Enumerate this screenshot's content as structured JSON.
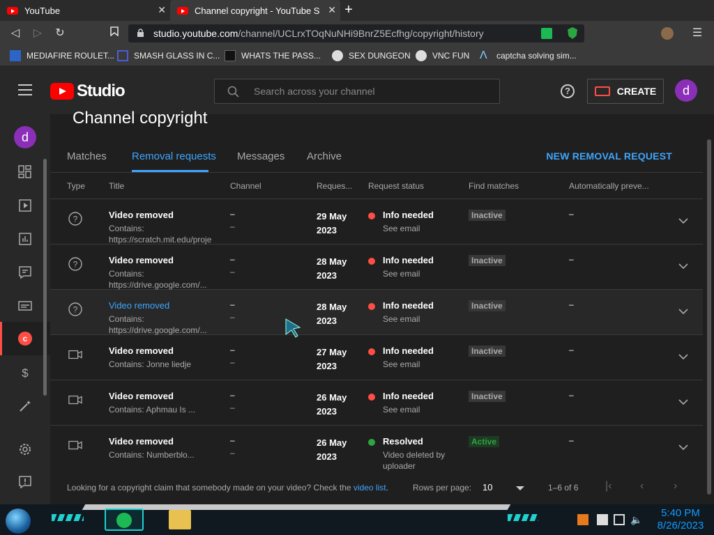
{
  "browser": {
    "tabs": [
      {
        "title": "YouTube"
      },
      {
        "title": "Channel copyright - YouTube Stud"
      }
    ],
    "url_host": "studio.youtube.com",
    "url_path": "/channel/UCLrxTOqNuNHi9BnrZ5Ecfhg/copyright/history",
    "bookmarks": [
      "MEDIAFIRE ROULET...",
      "SMASH GLASS IN C...",
      "WHATS THE PASS...",
      "SEX DUNGEON",
      "VNC FUN",
      "captcha solving sim..."
    ]
  },
  "header": {
    "logo_text": "Studio",
    "search_placeholder": "Search across your channel",
    "help_glyph": "?",
    "create_label": "CREATE",
    "avatar_letter": "d"
  },
  "sidebar": {
    "avatar_letter": "d",
    "copyright_letter": "c"
  },
  "main": {
    "title": "Channel copyright",
    "tabs": [
      "Matches",
      "Removal requests",
      "Messages",
      "Archive"
    ],
    "active_tab": "Removal requests",
    "new_request_label": "NEW REMOVAL REQUEST",
    "columns": [
      "Type",
      "Title",
      "Channel",
      "Reques...",
      "Request status",
      "Find matches",
      "Automatically preve..."
    ],
    "rows": [
      {
        "type": "question-icon",
        "title": "Video removed",
        "contains": "Contains: https://scratch.mit.edu/proje",
        "channel": "–",
        "channel_sub": "–",
        "date": "29 May 2023",
        "status": "Info needed",
        "status_sub": "See email",
        "status_color": "#ff4e45",
        "find_matches": "Inactive",
        "auto": "–"
      },
      {
        "type": "question-icon",
        "title": "Video removed",
        "contains": "Contains: https://drive.google.com/...",
        "channel": "–",
        "channel_sub": "–",
        "date": "28 May 2023",
        "status": "Info needed",
        "status_sub": "See email",
        "status_color": "#ff4e45",
        "find_matches": "Inactive",
        "auto": "–"
      },
      {
        "type": "question-icon",
        "title": "Video removed",
        "contains": "Contains: https://drive.google.com/...",
        "channel": "–",
        "channel_sub": "–",
        "date": "28 May 2023",
        "status": "Info needed",
        "status_sub": "See email",
        "status_color": "#ff4e45",
        "find_matches": "Inactive",
        "auto": "–"
      },
      {
        "type": "video-camera-icon",
        "title": "Video removed",
        "contains": "Contains: Jonne liedje",
        "channel": "–",
        "channel_sub": "–",
        "date": "27 May 2023",
        "status": "Info needed",
        "status_sub": "See email",
        "status_color": "#ff4e45",
        "find_matches": "Inactive",
        "auto": "–"
      },
      {
        "type": "video-camera-icon",
        "title": "Video removed",
        "contains": "Contains: Aphmau Is ...",
        "channel": "–",
        "channel_sub": "–",
        "date": "26 May 2023",
        "status": "Info needed",
        "status_sub": "See email",
        "status_color": "#ff4e45",
        "find_matches": "Inactive",
        "auto": "–"
      },
      {
        "type": "video-camera-icon",
        "title": "Video removed",
        "contains": "Contains: Numberblo...",
        "channel": "–",
        "channel_sub": "–",
        "date": "26 May 2023",
        "status": "Resolved",
        "status_sub": "Video deleted by uploader",
        "status_color": "#2ba640",
        "find_matches": "Active",
        "auto": "–"
      }
    ],
    "footer": {
      "text_before_link": "Looking for a copyright claim that somebody made on your video? Check the ",
      "link_text": "video list",
      "text_after_link": ".",
      "rows_per_page_label": "Rows per page:",
      "rows_per_page_value": "10",
      "range": "1–6 of 6"
    }
  },
  "taskbar": {
    "time": "5:40 PM",
    "date": "8/26/2023"
  }
}
